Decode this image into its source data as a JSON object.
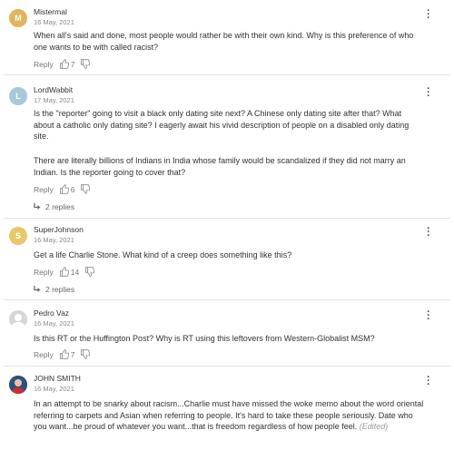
{
  "comments": [
    {
      "author": "Mistermal",
      "avatar_letter": "M",
      "avatar_color": "#e2b45c",
      "date": "16 May, 2021",
      "text": "When all's said and done, most people would rather be with their own kind. Why is this preference of who one wants to be with called racist?",
      "reply_label": "Reply",
      "likes": "7"
    },
    {
      "author": "LordWabbit",
      "avatar_letter": "L",
      "avatar_color": "#a9c8d8",
      "date": "17 May, 2021",
      "text_p1": "Is the \"reporter\" going to visit a black only dating site next?  A Chinese only dating site after that? What about a catholic only dating site?  I eagerly await his vivid description of people on a disabled only dating site.",
      "text_p2": "There are literally billions of Indians in India whose family would be scandalized if they did not marry an Indian.  Is the reporter going to cover that?",
      "reply_label": "Reply",
      "likes": "6",
      "replies": "2 replies"
    },
    {
      "author": "SuperJohnson",
      "avatar_letter": "S",
      "avatar_color": "#e8c86a",
      "date": "16 May, 2021",
      "text": "Get a life Charlie Stone. What kind of a creep does something like this?",
      "reply_label": "Reply",
      "likes": "14",
      "replies": "2 replies"
    },
    {
      "author": "Pedro Vaz",
      "date": "16 May, 2021",
      "text": "Is this RT or the Huffington Post? Why is RT using this leftovers from Western-Globalist MSM?",
      "reply_label": "Reply",
      "likes": "7"
    },
    {
      "author": "JOHN SMITH",
      "date": "16 May, 2021",
      "text": "In an attempt to be snarky about racism...Charlie must have missed the woke memo about the word oriental referring to carpets and Asian when referring to people. It's hard to take these people seriously. Date who you want...be proud of whatever you want...that is freedom regardless of how people feel.",
      "edited": "(Edited)"
    }
  ]
}
